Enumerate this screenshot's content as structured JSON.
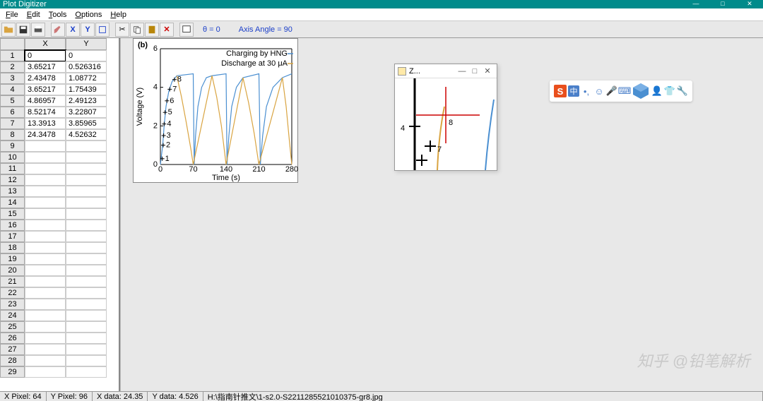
{
  "title": "Plot Digitizer",
  "menu": {
    "file": "File",
    "edit": "Edit",
    "tools": "Tools",
    "options": "Options",
    "help": "Help"
  },
  "toolbar_text": {
    "theta": "θ = 0",
    "axis": "Axis Angle = 90"
  },
  "columns": {
    "x": "X",
    "y": "Y"
  },
  "rows": [
    {
      "n": "1",
      "x": "0",
      "y": "0"
    },
    {
      "n": "2",
      "x": "3.65217",
      "y": "0.526316"
    },
    {
      "n": "3",
      "x": "2.43478",
      "y": "1.08772"
    },
    {
      "n": "4",
      "x": "3.65217",
      "y": "1.75439"
    },
    {
      "n": "5",
      "x": "4.86957",
      "y": "2.49123"
    },
    {
      "n": "6",
      "x": "8.52174",
      "y": "3.22807"
    },
    {
      "n": "7",
      "x": "13.3913",
      "y": "3.85965"
    },
    {
      "n": "8",
      "x": "24.3478",
      "y": "4.52632"
    },
    {
      "n": "9",
      "x": "",
      "y": ""
    },
    {
      "n": "10",
      "x": "",
      "y": ""
    },
    {
      "n": "11",
      "x": "",
      "y": ""
    },
    {
      "n": "12",
      "x": "",
      "y": ""
    },
    {
      "n": "13",
      "x": "",
      "y": ""
    },
    {
      "n": "14",
      "x": "",
      "y": ""
    },
    {
      "n": "15",
      "x": "",
      "y": ""
    },
    {
      "n": "16",
      "x": "",
      "y": ""
    },
    {
      "n": "17",
      "x": "",
      "y": ""
    },
    {
      "n": "18",
      "x": "",
      "y": ""
    },
    {
      "n": "19",
      "x": "",
      "y": ""
    },
    {
      "n": "20",
      "x": "",
      "y": ""
    },
    {
      "n": "21",
      "x": "",
      "y": ""
    },
    {
      "n": "22",
      "x": "",
      "y": ""
    },
    {
      "n": "23",
      "x": "",
      "y": ""
    },
    {
      "n": "24",
      "x": "",
      "y": ""
    },
    {
      "n": "25",
      "x": "",
      "y": ""
    },
    {
      "n": "26",
      "x": "",
      "y": ""
    },
    {
      "n": "27",
      "x": "",
      "y": ""
    },
    {
      "n": "28",
      "x": "",
      "y": ""
    },
    {
      "n": "29",
      "x": "",
      "y": ""
    }
  ],
  "chart_data": {
    "type": "line",
    "panel_label": "(b)",
    "xlabel": "Time (s)",
    "ylabel": "Voltage (V)",
    "xlim": [
      0,
      280
    ],
    "ylim": [
      0,
      6
    ],
    "xticks": [
      0,
      70,
      140,
      210,
      280
    ],
    "yticks": [
      0,
      2,
      4,
      6
    ],
    "legend": [
      "Charging by HNG",
      "Discharge at 30 μA"
    ],
    "series": [
      {
        "name": "Charging by HNG",
        "color": "#4a8fd1",
        "x": [
          0,
          5,
          8,
          12,
          18,
          25,
          35,
          70,
          72,
          75,
          80,
          88,
          98,
          110,
          140,
          142,
          146,
          152,
          162,
          176,
          210,
          213,
          218,
          226,
          240,
          260,
          280
        ],
        "y": [
          0,
          1.0,
          2.0,
          3.0,
          3.8,
          4.3,
          4.6,
          4.7,
          0,
          1.5,
          3.0,
          4.0,
          4.5,
          4.6,
          4.7,
          0,
          1.5,
          3.0,
          4.0,
          4.5,
          4.7,
          0,
          1.5,
          3.0,
          4.0,
          4.5,
          4.7
        ]
      },
      {
        "name": "Discharge at 30 μA",
        "color": "#d9a441",
        "x": [
          35,
          45,
          55,
          65,
          70,
          110,
          120,
          130,
          138,
          140,
          176,
          188,
          200,
          208,
          210,
          260,
          268,
          275,
          280
        ],
        "y": [
          4.6,
          3.5,
          2.2,
          0.8,
          0,
          4.6,
          3.5,
          2.0,
          0.4,
          0,
          4.5,
          3.2,
          1.6,
          0.3,
          0,
          4.5,
          3.0,
          1.2,
          0
        ]
      }
    ],
    "markers": [
      {
        "label": "1",
        "x": 4,
        "y": 0.3
      },
      {
        "label": "2",
        "x": 6,
        "y": 1.0
      },
      {
        "label": "3",
        "x": 7,
        "y": 1.5
      },
      {
        "label": "4",
        "x": 8,
        "y": 2.1
      },
      {
        "label": "5",
        "x": 10,
        "y": 2.7
      },
      {
        "label": "6",
        "x": 14,
        "y": 3.3
      },
      {
        "label": "7",
        "x": 20,
        "y": 3.9
      },
      {
        "label": "8",
        "x": 30,
        "y": 4.4
      }
    ]
  },
  "zoom": {
    "title": "Z...",
    "center_label": "8",
    "near_label": "7",
    "yaxis_label": "4"
  },
  "status": {
    "xpixel": "X Pixel: 64",
    "ypixel": "Y Pixel: 96",
    "xdata": "X data: 24.35",
    "ydata": "Y data: 4.526",
    "path": "H:\\指南针推文\\1-s2.0-S2211285521010375-gr8.jpg"
  },
  "ime": {
    "cn": "中"
  },
  "watermark": "知乎 @铅笔解析"
}
